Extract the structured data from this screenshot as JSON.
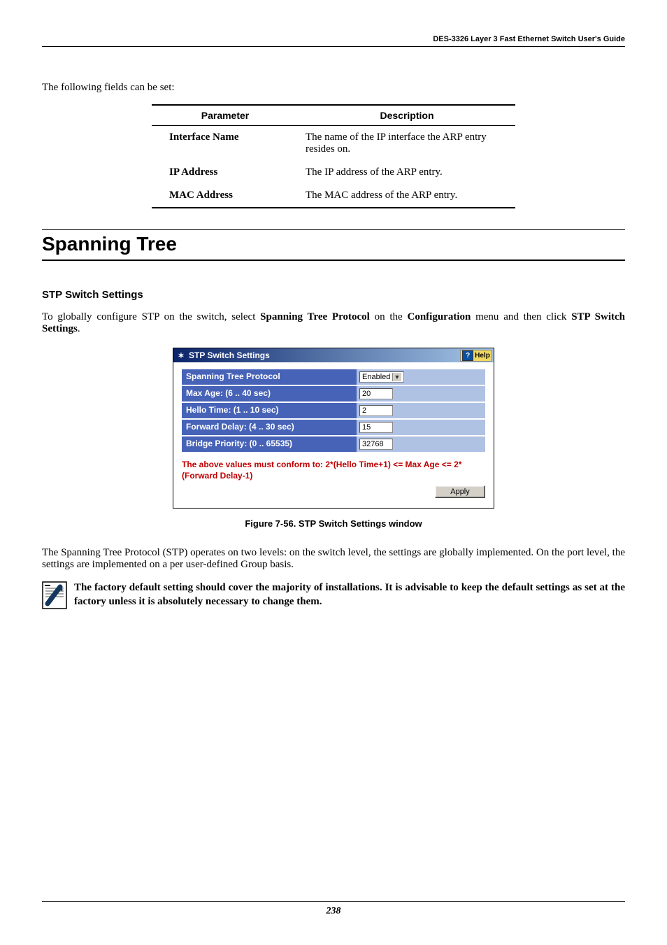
{
  "header": {
    "product_line": "DES-3326 Layer 3 Fast Ethernet Switch User's Guide"
  },
  "intro1": "The following fields can be set:",
  "table": {
    "headers": {
      "param": "Parameter",
      "desc": "Description"
    },
    "rows": [
      {
        "param": "Interface Name",
        "desc": "The name of the IP interface the ARP entry resides on."
      },
      {
        "param": "IP Address",
        "desc": "The IP address of the ARP entry."
      },
      {
        "param": "MAC Address",
        "desc": "The MAC address of the ARP entry."
      }
    ]
  },
  "section": {
    "title": "Spanning Tree"
  },
  "subsection": {
    "title": "STP Switch Settings"
  },
  "para2_a": "To globally configure STP on the switch, select ",
  "para2_b": "Spanning Tree Protocol",
  "para2_c": " on the ",
  "para2_d": "Configuration",
  "para2_e": " menu and then click ",
  "para2_f": "STP Switch Settings",
  "para2_g": ".",
  "screenshot": {
    "title": "STP Switch Settings",
    "help": "Help",
    "rows": [
      {
        "label": "Spanning Tree Protocol",
        "type": "select",
        "value": "Enabled"
      },
      {
        "label": "Max Age: (6 .. 40 sec)",
        "type": "text",
        "value": "20"
      },
      {
        "label": "Hello Time: (1 .. 10 sec)",
        "type": "text",
        "value": "2"
      },
      {
        "label": "Forward Delay: (4 .. 30 sec)",
        "type": "text",
        "value": "15"
      },
      {
        "label": "Bridge Priority: (0 .. 65535)",
        "type": "text",
        "value": "32768"
      }
    ],
    "note": "The above values must conform to: 2*(Hello Time+1) <= Max Age <= 2*(Forward Delay-1)",
    "apply": "Apply"
  },
  "figure_caption": "Figure 7-56.  STP Switch Settings window",
  "para3": "The Spanning Tree Protocol (STP) operates on two levels: on the switch level, the settings are globally implemented.  On the port level, the settings are implemented on a per user-defined Group basis.",
  "note_block": "The factory default setting should cover the majority of installations. It is advisable to keep the default settings as set at the factory unless it is absolutely necessary to change them.",
  "page_number": "238"
}
